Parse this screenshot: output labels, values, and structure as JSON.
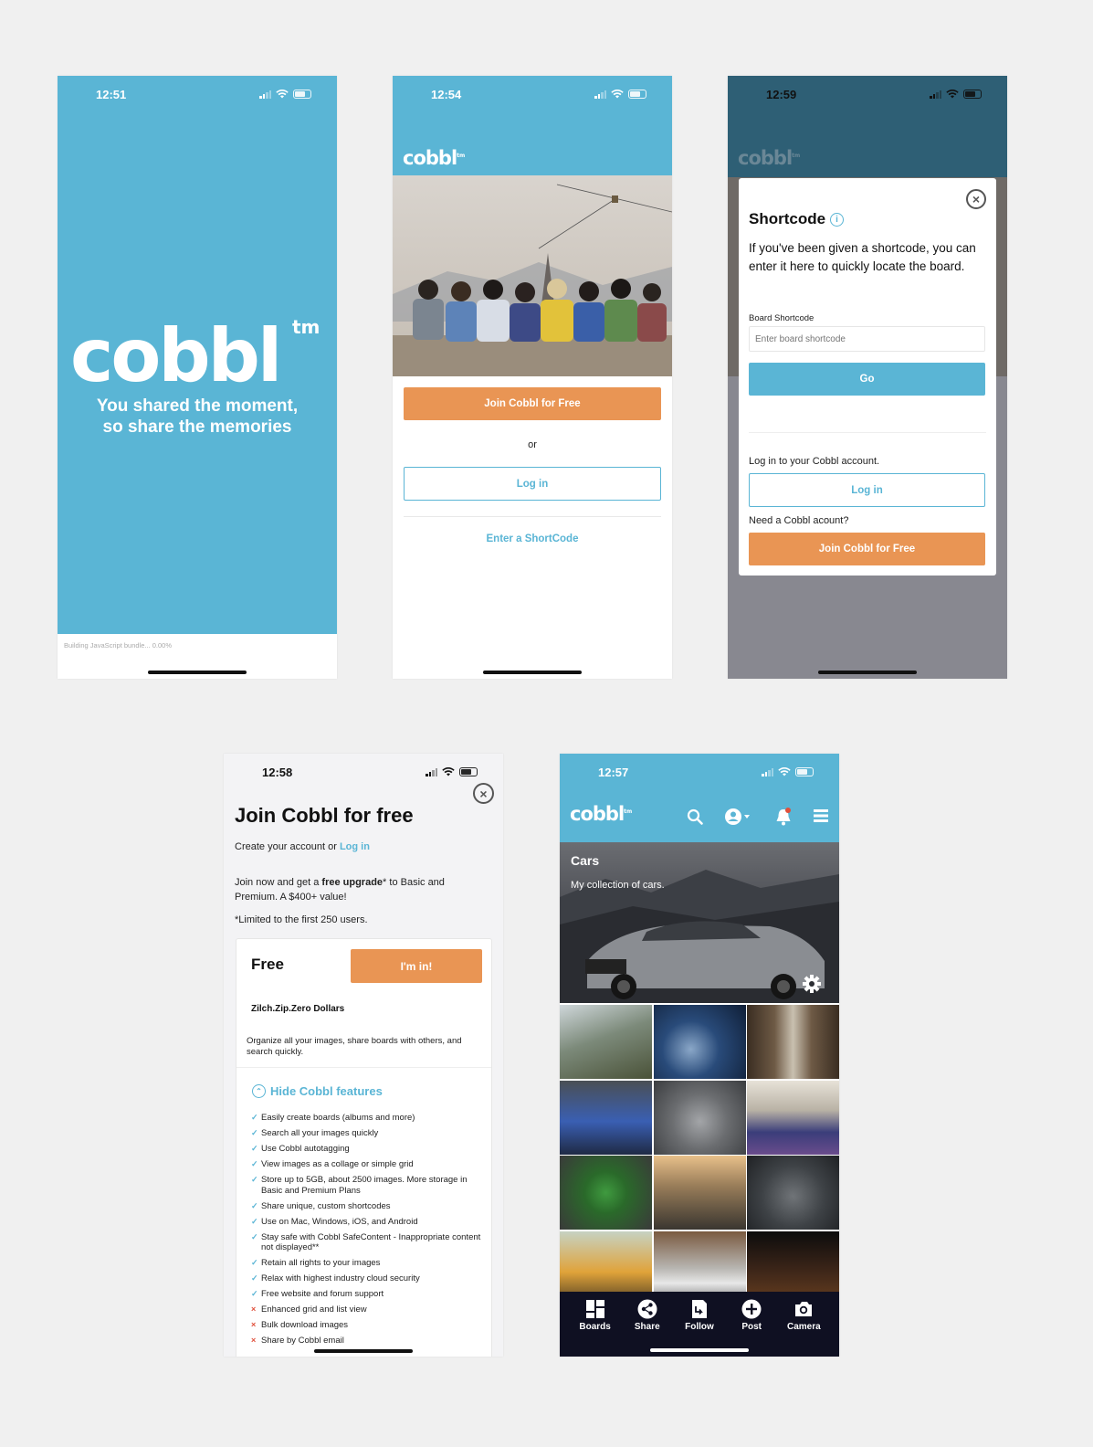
{
  "brand": {
    "logo": "cobbl",
    "tm": "tm",
    "blue": "#5ab5d5",
    "orange": "#e99554",
    "navy": "#0f1022"
  },
  "screen1": {
    "time": "12:51",
    "tagline_line1": "You shared the moment,",
    "tagline_line2": "so share the memories",
    "bundle_status": "Building JavaScript bundle... 0.00%"
  },
  "screen2": {
    "time": "12:54",
    "join_label": "Join Cobbl for Free",
    "or_label": "or",
    "login_label": "Log in",
    "shortcode_link": "Enter a ShortCode"
  },
  "screen3": {
    "time": "12:59",
    "modal_title": "Shortcode",
    "info_icon": "info-icon",
    "description": "If you've been given a shortcode, you can enter it here to quickly locate the board.",
    "field_label": "Board Shortcode",
    "field_placeholder": "Enter board shortcode",
    "go_label": "Go",
    "login_prompt": "Log in to your Cobbl account.",
    "login_label": "Log in",
    "need_account": "Need a Cobbl acount?",
    "join_label": "Join Cobbl for Free"
  },
  "screen4": {
    "time": "12:58",
    "title": "Join Cobbl for free",
    "subtitle_prefix": "Create your account or ",
    "login_link": "Log in",
    "promo_prefix": "Join now and get a ",
    "promo_bold": "free upgrade",
    "promo_suffix": "* to Basic and Premium. A $400+ value!",
    "limit_note": "*Limited to the first 250 users.",
    "plan_name": "Free",
    "cta_label": "I'm in!",
    "price_label": "Zilch.Zip.Zero Dollars",
    "plan_desc": "Organize all your images, share boards with others, and search quickly.",
    "toggle_label": "Hide Cobbl features",
    "features": [
      {
        "text": "Easily create boards (albums and more)",
        "included": true
      },
      {
        "text": "Search all your images quickly",
        "included": true
      },
      {
        "text": "Use Cobbl autotagging",
        "included": true
      },
      {
        "text": "View images as a collage or simple grid",
        "included": true
      },
      {
        "text": "Store up to 5GB, about 2500 images. More storage in Basic and Premium Plans",
        "included": true
      },
      {
        "text": "Share unique, custom shortcodes",
        "included": true
      },
      {
        "text": "Use on Mac, Windows, iOS, and Android",
        "included": true
      },
      {
        "text": "Stay safe with Cobbl SafeContent - Inappropriate content not displayed**",
        "included": true
      },
      {
        "text": "Retain all rights to your images",
        "included": true
      },
      {
        "text": "Relax with highest industry cloud security",
        "included": true
      },
      {
        "text": "Free website and forum support",
        "included": true
      },
      {
        "text": "Enhanced grid and list view",
        "included": false
      },
      {
        "text": "Bulk download images",
        "included": false
      },
      {
        "text": "Share by Cobbl email",
        "included": false
      }
    ]
  },
  "screen5": {
    "time": "12:57",
    "board_title": "Cars",
    "board_desc": "My collection of cars.",
    "tabs": [
      {
        "label": "Boards",
        "icon": "boards-icon"
      },
      {
        "label": "Share",
        "icon": "share-icon"
      },
      {
        "label": "Follow",
        "icon": "follow-icon"
      },
      {
        "label": "Post",
        "icon": "post-icon"
      },
      {
        "label": "Camera",
        "icon": "camera-icon"
      }
    ]
  }
}
